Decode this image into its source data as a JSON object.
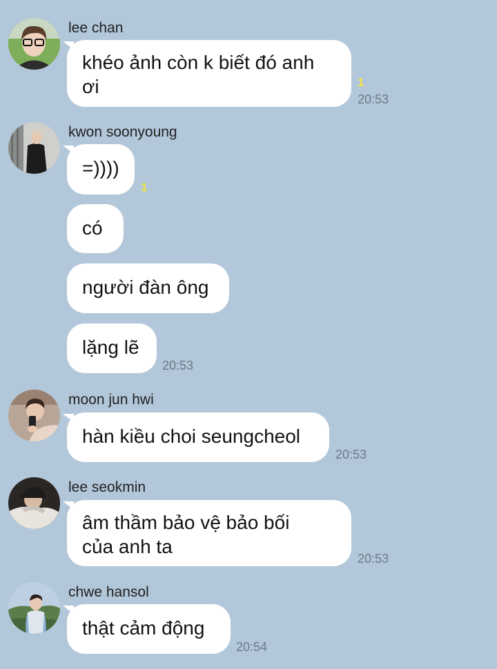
{
  "chat": {
    "groups": [
      {
        "sender": "lee chan",
        "avatar": "avatar-lee-chan",
        "messages": [
          {
            "text": "khéo ảnh còn k biết đó anh ơi",
            "unread": "1",
            "time": "20:53"
          }
        ]
      },
      {
        "sender": "kwon soonyoung",
        "avatar": "avatar-kwon-soonyoung",
        "messages": [
          {
            "text": "=))))",
            "unread": "1"
          },
          {
            "text": "có"
          },
          {
            "text": "người đàn ông"
          },
          {
            "text": "lặng lẽ",
            "time": "20:53"
          }
        ]
      },
      {
        "sender": "moon jun hwi",
        "avatar": "avatar-moon-jun-hwi",
        "messages": [
          {
            "text": "hàn kiều choi seungcheol",
            "time": "20:53"
          }
        ]
      },
      {
        "sender": "lee seokmin",
        "avatar": "avatar-lee-seokmin",
        "messages": [
          {
            "text": "âm thầm bảo vệ bảo bối của anh ta",
            "time": "20:53"
          }
        ]
      },
      {
        "sender": "chwe hansol",
        "avatar": "avatar-chwe-hansol",
        "messages": [
          {
            "text": "thật cảm động",
            "time": "20:54"
          }
        ]
      }
    ]
  },
  "colors": {
    "background": "#b2c7d9",
    "bubble": "#ffffff",
    "unread": "#f5e53a",
    "timestamp": "#6c7a86"
  }
}
